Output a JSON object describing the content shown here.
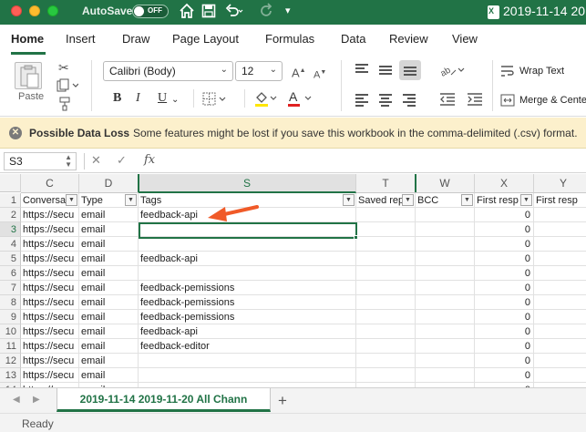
{
  "titlebar": {
    "autosave_label": "AutoSave",
    "autosave_state": "OFF",
    "document_title": "2019-11-14 20",
    "icons": [
      "home-icon",
      "save-icon",
      "undo-icon",
      "redo-icon",
      "customize-toolbar-icon"
    ]
  },
  "ribbon_tabs": [
    "Home",
    "Insert",
    "Draw",
    "Page Layout",
    "Formulas",
    "Data",
    "Review",
    "View"
  ],
  "active_tab": "Home",
  "ribbon": {
    "paste_label": "Paste",
    "font_name": "Calibri (Body)",
    "font_size": "12",
    "bold": "B",
    "italic": "I",
    "underline": "U",
    "wrap_text": "Wrap Text",
    "merge_center": "Merge & Cente",
    "font_color_accent": "#e02020",
    "highlight_accent": "#ffe600"
  },
  "message_bar": {
    "title": "Possible Data Loss",
    "text": "Some features might be lost if you save this workbook in the comma-delimited (.csv) format."
  },
  "formula_bar": {
    "name_box": "S3",
    "fx": "fx",
    "value": ""
  },
  "grid": {
    "columns": [
      "C",
      "D",
      "S",
      "T",
      "W",
      "X",
      "Y"
    ],
    "selected_column": "S",
    "selected_cell": "S3",
    "rows": [
      {
        "n": "1",
        "cells": [
          "Conversat",
          "Type",
          "Tags",
          "Saved rep",
          "BCC",
          "First resp",
          "First resp"
        ]
      },
      {
        "n": "2",
        "cells": [
          "https://secu",
          "email",
          "feedback-api",
          "",
          "",
          "0",
          ""
        ]
      },
      {
        "n": "3",
        "cells": [
          "https://secu",
          "email",
          "",
          "",
          "",
          "0",
          ""
        ]
      },
      {
        "n": "4",
        "cells": [
          "https://secu",
          "email",
          "",
          "",
          "",
          "0",
          ""
        ]
      },
      {
        "n": "5",
        "cells": [
          "https://secu",
          "email",
          "feedback-api",
          "",
          "",
          "0",
          ""
        ]
      },
      {
        "n": "6",
        "cells": [
          "https://secu",
          "email",
          "",
          "",
          "",
          "0",
          ""
        ]
      },
      {
        "n": "7",
        "cells": [
          "https://secu",
          "email",
          "feedback-pemissions",
          "",
          "",
          "0",
          ""
        ]
      },
      {
        "n": "8",
        "cells": [
          "https://secu",
          "email",
          "feedback-pemissions",
          "",
          "",
          "0",
          ""
        ]
      },
      {
        "n": "9",
        "cells": [
          "https://secu",
          "email",
          "feedback-pemissions",
          "",
          "",
          "0",
          ""
        ]
      },
      {
        "n": "10",
        "cells": [
          "https://secu",
          "email",
          "feedback-api",
          "",
          "",
          "0",
          ""
        ]
      },
      {
        "n": "11",
        "cells": [
          "https://secu",
          "email",
          "feedback-editor",
          "",
          "",
          "0",
          ""
        ]
      },
      {
        "n": "12",
        "cells": [
          "https://secu",
          "email",
          "",
          "",
          "",
          "0",
          ""
        ]
      },
      {
        "n": "13",
        "cells": [
          "https://secu",
          "email",
          "",
          "",
          "",
          "0",
          ""
        ]
      },
      {
        "n": "14",
        "cells": [
          "https://secu",
          "email",
          "",
          "",
          "",
          "0",
          ""
        ]
      }
    ]
  },
  "sheet_tab": "2019-11-14 2019-11-20 All Chann",
  "status": "Ready",
  "accent_color": "#217346",
  "annotation_arrow_color": "#f05a28"
}
